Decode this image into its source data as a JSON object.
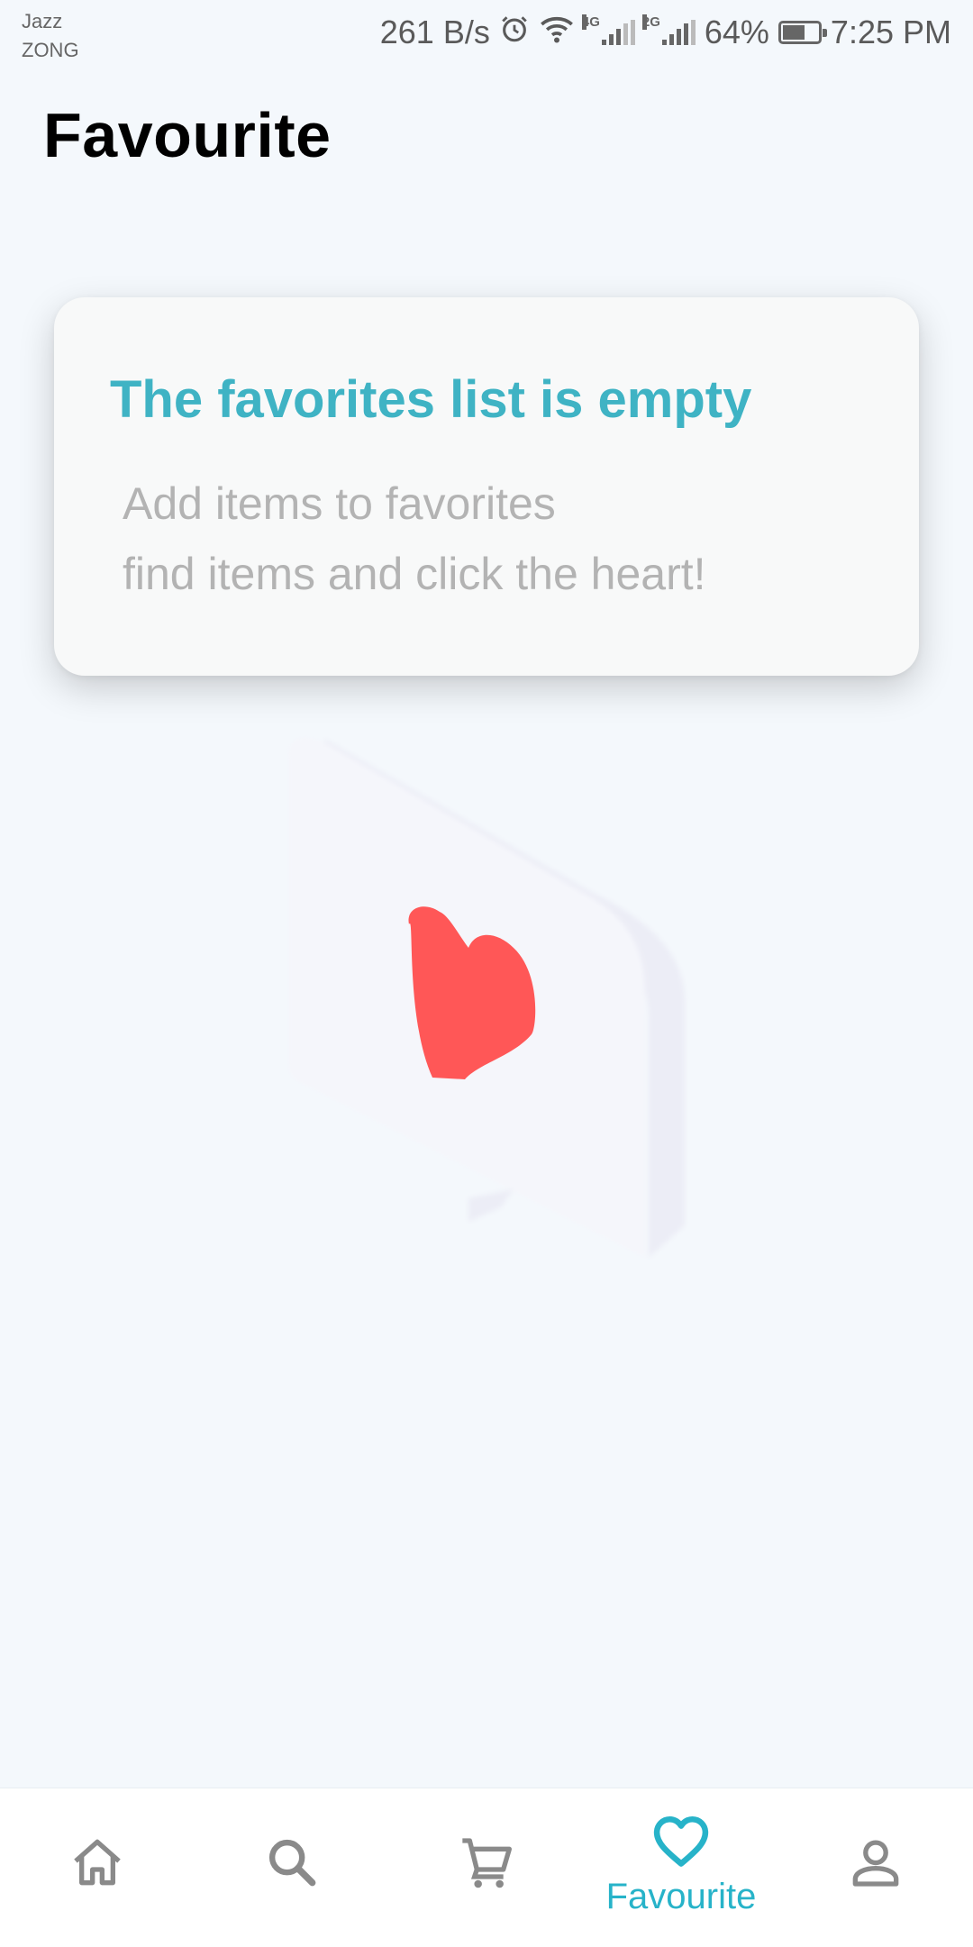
{
  "status_bar": {
    "carrier_1": "Jazz",
    "carrier_2": "ZONG",
    "speed": "261 B/s",
    "net_tag_1": "4G",
    "net_tag_2": "2G",
    "battery_percent": "64%",
    "battery_level": 0.64,
    "time": "7:25 PM"
  },
  "header": {
    "title": "Favourite"
  },
  "empty_state": {
    "title": "The favorites list is empty",
    "line_1": "Add items to favorites",
    "line_2": "find items and click the heart!"
  },
  "bottom_nav": {
    "items": [
      {
        "icon": "home-icon"
      },
      {
        "icon": "search-icon"
      },
      {
        "icon": "cart-icon"
      },
      {
        "icon": "heart-icon",
        "label": "Favourite",
        "active": true
      },
      {
        "icon": "person-icon"
      }
    ],
    "active_color": "#27b3c9",
    "inactive_color": "#8a8a8a"
  },
  "colors": {
    "background": "#f4f8fc",
    "accent": "#3fb3c4",
    "heart": "#ff5757"
  }
}
